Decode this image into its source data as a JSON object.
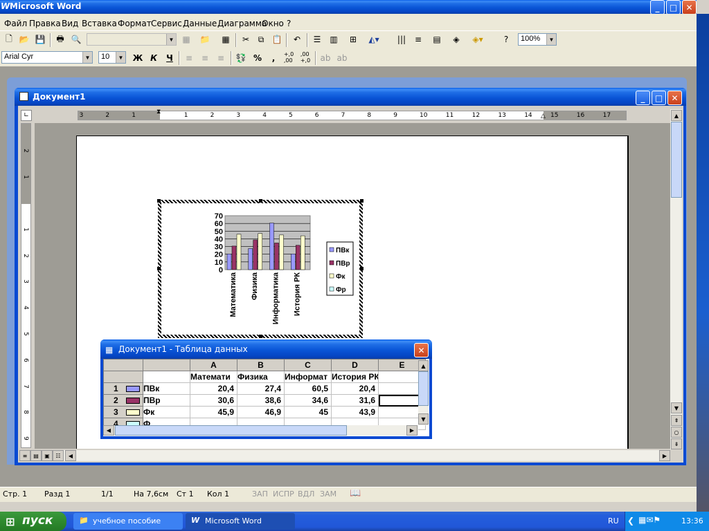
{
  "app": {
    "title": "Microsoft Word"
  },
  "menu": [
    "Файл",
    "Правка",
    "Вид",
    "Вставка",
    "Формат",
    "Сервис",
    "Данные",
    "Диаграмма",
    "Окно",
    "?"
  ],
  "toolbar": {
    "zoom": "100%",
    "font": "Arial Cyr",
    "size": "10",
    "bold": "Ж",
    "italic": "К",
    "underline": "Ч",
    "percent": "%",
    "comma": ",",
    "inc_dec": "+,0\n,00",
    "dec_dec": ",00\n+,0"
  },
  "doc_window": {
    "title": "Документ1"
  },
  "ruler": {
    "numbers": [
      "3",
      "2",
      "1",
      "1",
      "2",
      "3",
      "4",
      "5",
      "6",
      "7",
      "8",
      "9",
      "10",
      "11",
      "12",
      "13",
      "14",
      "15",
      "16",
      "17"
    ]
  },
  "vruler": {
    "numbers": [
      "2",
      "1",
      "1",
      "2",
      "3",
      "4",
      "5",
      "6",
      "7",
      "8",
      "9"
    ]
  },
  "chart_data": {
    "type": "bar",
    "categories": [
      "Математика",
      "Физика",
      "Информатика",
      "История РК"
    ],
    "series": [
      {
        "name": "ПВк",
        "values": [
          20.4,
          27.4,
          60.5,
          20.4
        ],
        "color": "#9999ff"
      },
      {
        "name": "ПВр",
        "values": [
          30.6,
          38.6,
          34.6,
          31.6
        ],
        "color": "#993366"
      },
      {
        "name": "Фк",
        "values": [
          45.9,
          46.9,
          45,
          43.9
        ],
        "color": "#ffffcc"
      },
      {
        "name": "Фр",
        "values": [
          null,
          null,
          null,
          null
        ],
        "color": "#ccffff"
      }
    ],
    "yticks": [
      "70",
      "60",
      "50",
      "40",
      "30",
      "20",
      "10",
      "0"
    ],
    "ylim": [
      0,
      70
    ],
    "legend": "right"
  },
  "datasheet": {
    "title": "Документ1 - Таблица данных",
    "columns": [
      "A",
      "B",
      "C",
      "D",
      "E"
    ],
    "headers": [
      "Математи",
      "Физика",
      "Информат",
      "История РК",
      ""
    ],
    "rows": [
      {
        "num": "1",
        "name": "ПВк",
        "values": [
          "20,4",
          "27,4",
          "60,5",
          "20,4",
          ""
        ],
        "swatch": "#9999ff"
      },
      {
        "num": "2",
        "name": "ПВр",
        "values": [
          "30,6",
          "38,6",
          "34,6",
          "31,6",
          ""
        ],
        "swatch": "#993366"
      },
      {
        "num": "3",
        "name": "Фк",
        "values": [
          "45,9",
          "46,9",
          "45",
          "43,9",
          ""
        ],
        "swatch": "#ffffcc"
      },
      {
        "num": "4",
        "name": "Ф",
        "values": [
          "",
          "",
          "",
          "",
          ""
        ],
        "swatch": "#ccffff"
      }
    ]
  },
  "status": {
    "page": "Стр. 1",
    "section": "Разд 1",
    "pages": "1/1",
    "at": "На 7,6см",
    "line": "Ст 1",
    "col": "Кол 1",
    "rec": "ЗАП",
    "trk": "ИСПР",
    "ext": "ВДЛ",
    "ovr": "ЗАМ"
  },
  "taskbar": {
    "start": "пуск",
    "items": [
      "учебное пособие",
      "Microsoft Word"
    ],
    "lang": "RU",
    "time": "13:36"
  }
}
